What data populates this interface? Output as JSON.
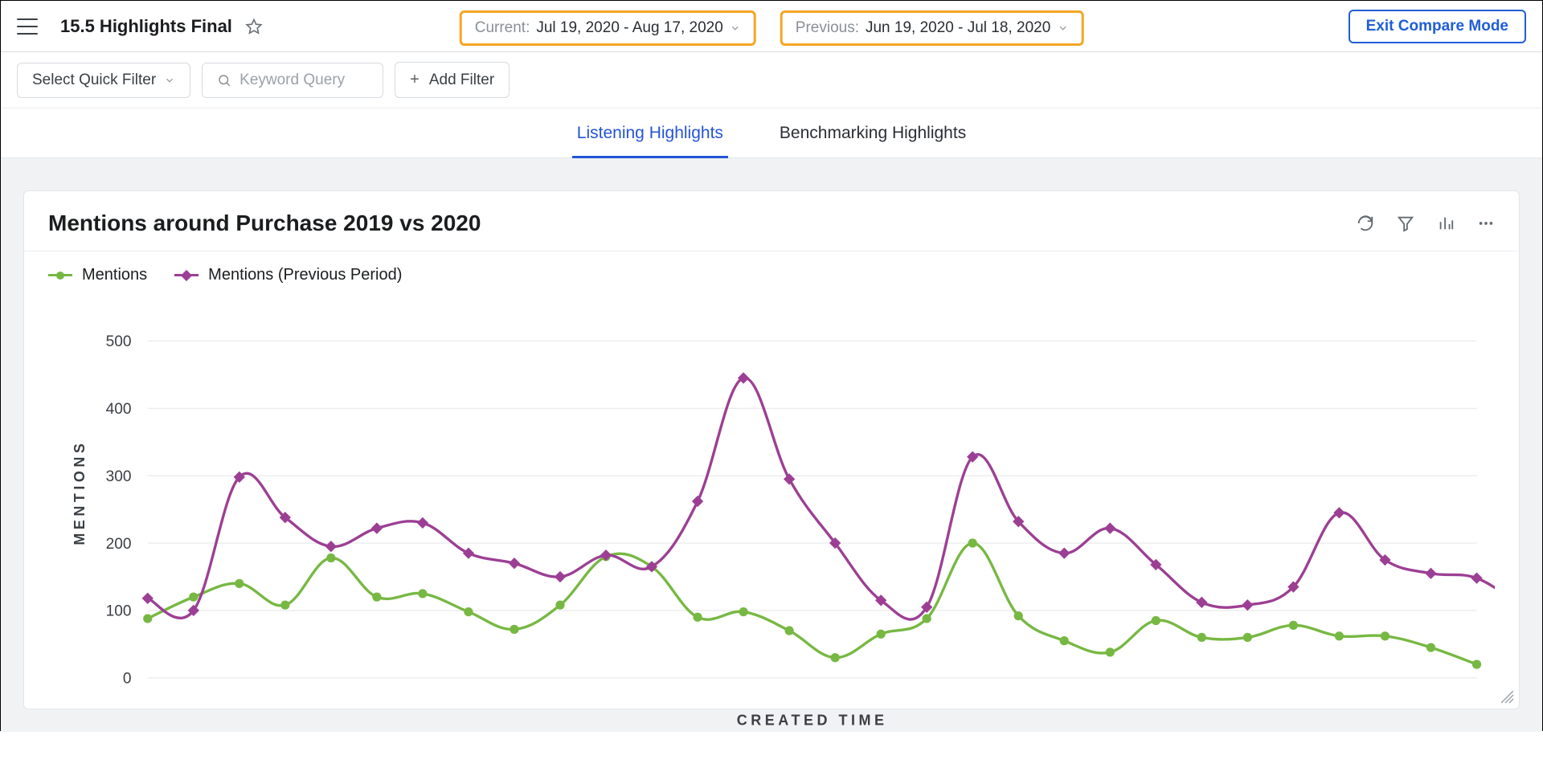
{
  "header": {
    "title": "15.5 Highlights Final",
    "current_label": "Current:",
    "current_value": "Jul 19, 2020 - Aug 17, 2020",
    "previous_label": "Previous:",
    "previous_value": "Jun 19, 2020 - Jul 18, 2020",
    "exit_label": "Exit Compare Mode"
  },
  "filters": {
    "quick_filter_label": "Select Quick Filter",
    "keyword_placeholder": "Keyword Query",
    "add_filter_label": "Add Filter"
  },
  "tabs": {
    "listening": "Listening Highlights",
    "benchmarking": "Benchmarking Highlights",
    "active": "listening"
  },
  "card": {
    "title": "Mentions around Purchase 2019 vs 2020",
    "legend": {
      "current": "Mentions",
      "previous": "Mentions (Previous Period)"
    }
  },
  "chart_data": {
    "type": "line",
    "xlabel": "CREATED TIME",
    "ylabel": "MENTIONS",
    "ylim": [
      0,
      550
    ],
    "yticks": [
      0,
      100,
      200,
      300,
      400,
      500
    ],
    "x": [
      1,
      2,
      3,
      4,
      5,
      6,
      7,
      8,
      9,
      10,
      11,
      12,
      13,
      14,
      15,
      16,
      17,
      18,
      19,
      20,
      21,
      22,
      23,
      24,
      25,
      26,
      27,
      28,
      29,
      30
    ],
    "series": [
      {
        "name": "Mentions",
        "color": "#77b843",
        "marker": "circle",
        "values": [
          88,
          120,
          140,
          108,
          178,
          120,
          125,
          98,
          72,
          108,
          180,
          165,
          90,
          98,
          70,
          30,
          65,
          88,
          200,
          92,
          55,
          38,
          85,
          60,
          60,
          78,
          62,
          62,
          45,
          20
        ]
      },
      {
        "name": "Mentions (Previous Period)",
        "color": "#9c3f94",
        "marker": "diamond",
        "values": [
          118,
          100,
          298,
          238,
          195,
          222,
          230,
          185,
          170,
          150,
          182,
          165,
          262,
          445,
          295,
          200,
          115,
          105,
          328,
          232,
          185,
          222,
          168,
          112,
          108,
          135,
          245,
          175,
          155,
          148,
          105
        ]
      }
    ]
  }
}
